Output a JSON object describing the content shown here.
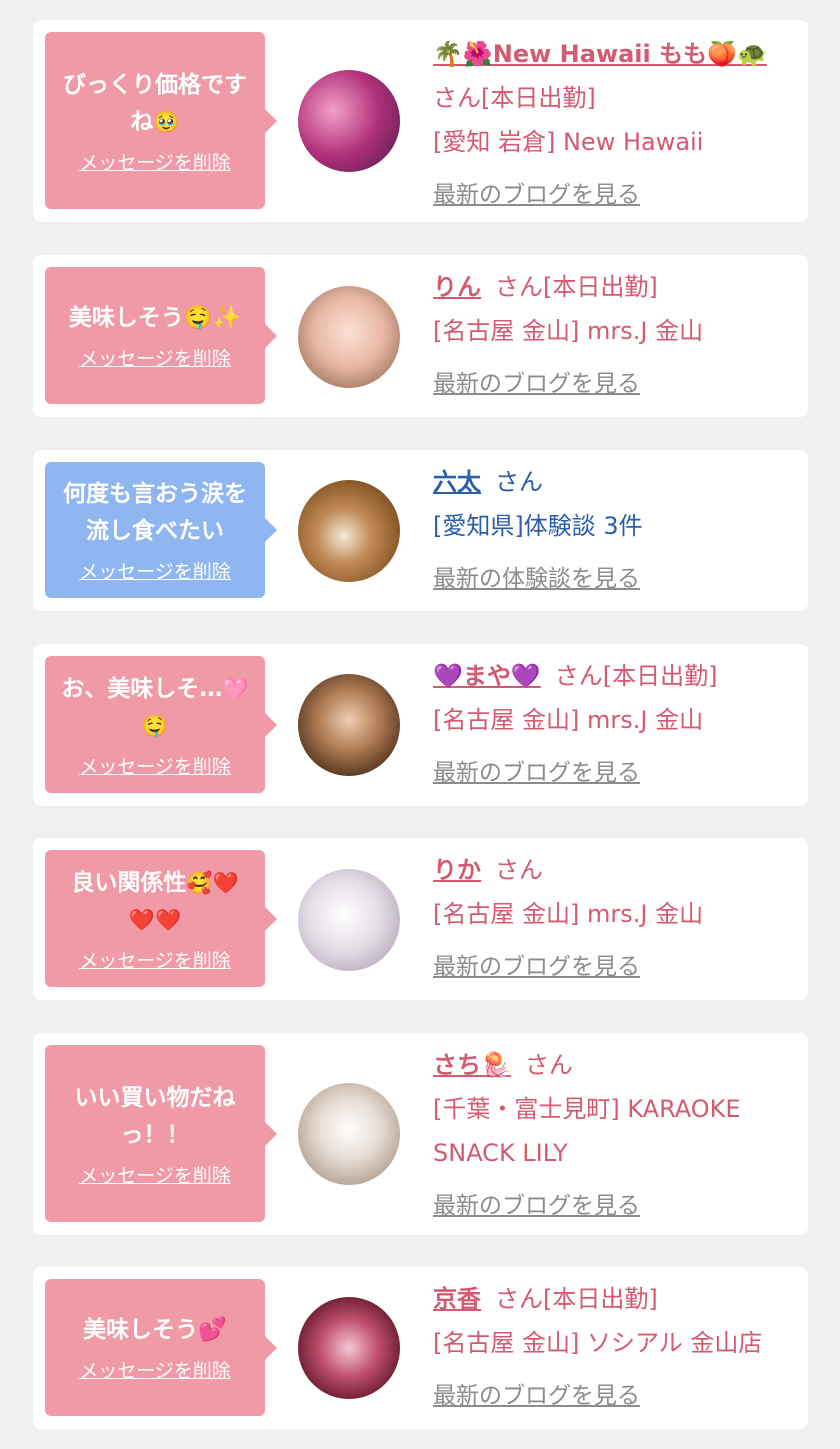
{
  "delete_label": "メッセージを削除",
  "items": [
    {
      "message": "びっくり価格ですね🥹",
      "name": "🌴🌺New Hawaii もも🍑🐢",
      "suffix": "さん[本日出勤]",
      "shop": "[愛知 岩倉] New Hawaii",
      "link": "最新のブログを見る"
    },
    {
      "message": "美味しそう🤤✨",
      "name": "りん",
      "suffix": "さん[本日出勤]",
      "shop": "[名古屋 金山] mrs.J 金山",
      "link": "最新のブログを見る"
    },
    {
      "message": "何度も言おう涙を流し食べたい",
      "name": "六太",
      "suffix": "さん",
      "shop": "[愛知県]体験談 3件",
      "link": "最新の体験談を見る"
    },
    {
      "message": "お、美味しそ…🩷🤤",
      "name": "💜まや💜",
      "suffix": "さん[本日出勤]",
      "shop": "[名古屋 金山] mrs.J 金山",
      "link": "最新のブログを見る"
    },
    {
      "message": "良い関係性🥰❤️❤️❤️",
      "name": "りか",
      "suffix": "さん",
      "shop": "[名古屋 金山] mrs.J 金山",
      "link": "最新のブログを見る"
    },
    {
      "message": "いい買い物だねっ！！",
      "name": "さち🪼",
      "suffix": "さん",
      "shop": "[千葉・富士見町] KARAOKE",
      "shop2": "SNACK LILY",
      "link": "最新のブログを見る"
    },
    {
      "message": "美味しそう💕",
      "name": "京香",
      "suffix": "さん[本日出勤]",
      "shop": "[名古屋 金山] ソシアル 金山店",
      "link": "最新のブログを見る"
    }
  ],
  "colors": {
    "pink_bubble": "#ef9aa6",
    "blue_bubble": "#8fb6f0",
    "name_pink": "#d45a72",
    "name_blue": "#2a5ea8",
    "link_gray": "#8c8c8c"
  }
}
